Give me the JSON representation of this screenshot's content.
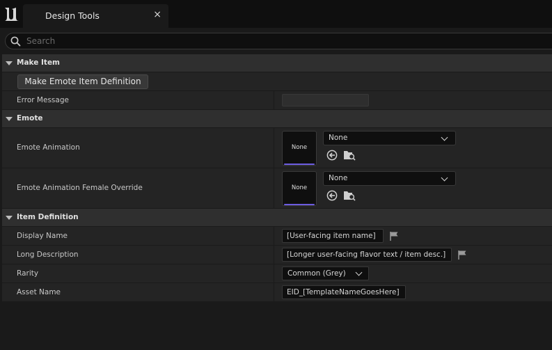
{
  "tab": {
    "title": "Design Tools",
    "close": "×"
  },
  "search": {
    "placeholder": "Search",
    "value": ""
  },
  "sections": {
    "make_item": {
      "label": "Make Item",
      "button_label": "Make Emote Item Definition",
      "error_message_label": "Error Message",
      "error_message_value": ""
    },
    "emote": {
      "label": "Emote",
      "animation_label": "Emote Animation",
      "animation_thumb": "None",
      "animation_value": "None",
      "female_label": "Emote Animation Female Override",
      "female_thumb": "None",
      "female_value": "None"
    },
    "item_definition": {
      "label": "Item Definition",
      "display_name_label": "Display Name",
      "display_name_value": "[User-facing item name]",
      "long_desc_label": "Long Description",
      "long_desc_value": "[Longer user-facing flavor text / item desc.]",
      "rarity_label": "Rarity",
      "rarity_value": "Common (Grey)",
      "asset_name_label": "Asset Name",
      "asset_name_value": "EID_[TemplateNameGoesHere]"
    }
  },
  "icons": [
    "unreal-logo-icon",
    "close-icon",
    "search-icon",
    "collapse-arrow-icon",
    "chevron-down-icon",
    "use-selected-asset-icon",
    "browse-asset-icon",
    "localization-flag-icon"
  ],
  "colors": {
    "accent": "#6b5be0",
    "panel": "#1a1a1a",
    "row": "#242424",
    "category": "#2f2f2f"
  }
}
